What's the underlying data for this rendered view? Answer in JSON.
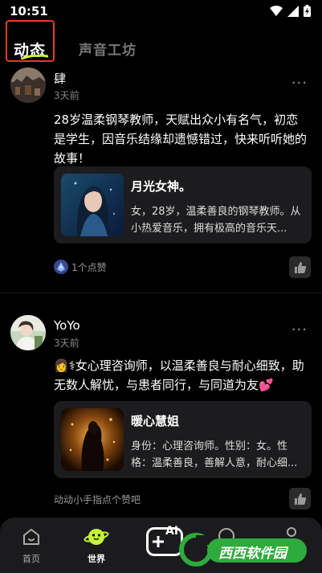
{
  "status": {
    "time": "10:51"
  },
  "tabs": {
    "active": "动态",
    "inactive": "声音工坊"
  },
  "posts": [
    {
      "username": "肆",
      "time": "3天前",
      "text": "28岁温柔钢琴教师，天赋出众小有名气，初恋是学生，因音乐结缘却遗憾错过，快来听听她的故事！",
      "card": {
        "title": "月光女神。",
        "desc": "女，28岁，温柔善良的钢琴教师。从小热爱音乐，拥有极高的音乐天..."
      },
      "likes": "1个点赞"
    },
    {
      "username": "YoYo",
      "time": "3天前",
      "text_emoji_left": "👩",
      "text": "⚕女心理咨询师，以温柔善良与耐心细致，助无数人解忧，与患者同行，与同道为友",
      "text_emoji_right": "💕",
      "card": {
        "title": "暖心慧姐",
        "desc": "身份：心理咨询师。性别：女。性格：温柔善良，善解人意，耐心细..."
      },
      "likes": "动动小手指点个赞吧"
    }
  ],
  "nav": {
    "home": "首页",
    "world": "世界",
    "create": "AI",
    "messages": "",
    "profile": ""
  },
  "watermark": {
    "text": "西西软件园",
    "url": "CR173.COM"
  },
  "colors": {
    "accent_red": "#e33a2c",
    "lime": "#c6f23a",
    "watermark_green": "#2faa3c"
  }
}
